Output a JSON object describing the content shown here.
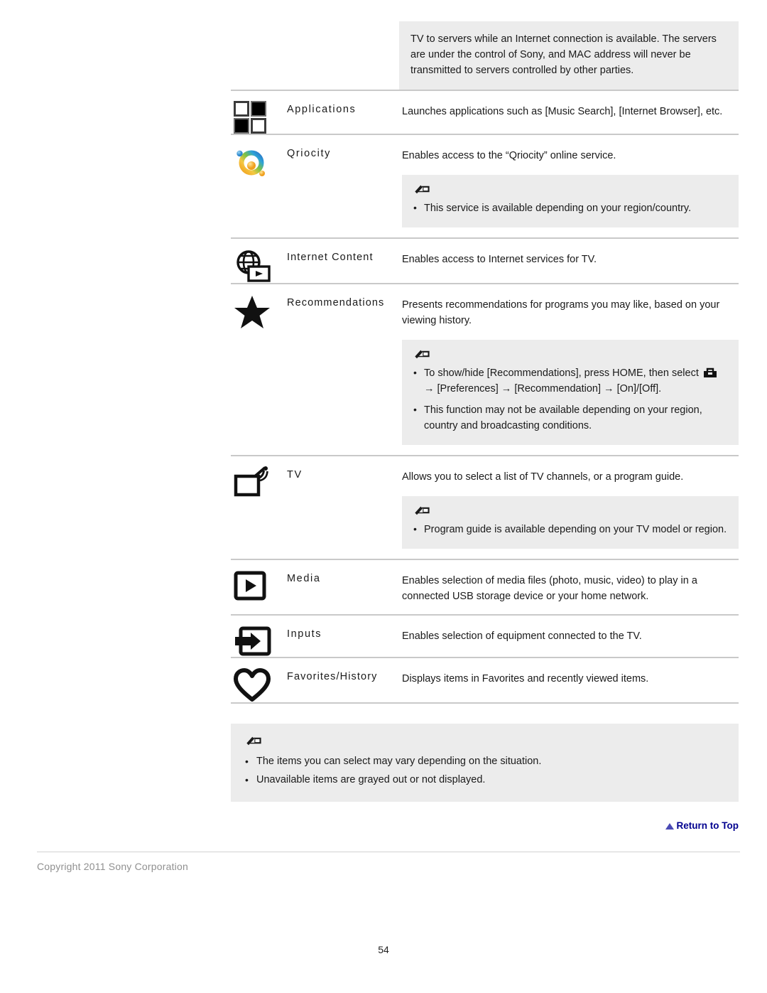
{
  "document": {
    "page_number": "54",
    "copyright": "Copyright 2011 Sony Corporation",
    "return_to_top": "Return to Top"
  },
  "carryover_note": {
    "text": "TV to servers while an Internet connection is available. The servers are under the control of Sony, and MAC address will never be transmitted to servers controlled by other parties."
  },
  "rows": [
    {
      "icon": "applications-grid-icon",
      "label": "Applications",
      "description": "Launches applications such as [Music Search], [Internet Browser], etc."
    },
    {
      "icon": "qriocity-icon",
      "label": "Qriocity",
      "description": "Enables access to the “Qriocity” online service.",
      "note": {
        "items": [
          "This service is available depending on your region/country."
        ]
      }
    },
    {
      "icon": "internet-content-globe-icon",
      "label": "Internet Content",
      "description": "Enables access to Internet services for TV."
    },
    {
      "icon": "recommendations-star-icon",
      "label": "Recommendations",
      "description": "Presents recommendations for programs you may like, based on your viewing history.",
      "note": {
        "items_rich": [
          {
            "before": "To show/hide [Recommendations], press HOME, then select ",
            "icon": "toolbox-icon",
            "after": " → [Preferences] → [Recommendation] → [On]/[Off]."
          },
          {
            "before": "This function may not be available depending on your region, country and broadcasting conditions.",
            "icon": null,
            "after": ""
          }
        ]
      }
    },
    {
      "icon": "tv-antenna-icon",
      "label": "TV",
      "description": "Allows you to select a list of TV channels, or a program guide.",
      "note": {
        "items": [
          "Program guide is available depending on your TV model or region."
        ]
      }
    },
    {
      "icon": "media-play-icon",
      "label": "Media",
      "description": "Enables selection of media files (photo, music, video) to play in a connected USB storage device or your home network."
    },
    {
      "icon": "inputs-arrow-icon",
      "label": "Inputs",
      "description": "Enables selection of equipment connected to the TV."
    },
    {
      "icon": "favorites-heart-icon",
      "label": "Favorites/History",
      "description": "Displays items in Favorites and recently viewed items."
    }
  ],
  "bottom_note": {
    "items": [
      "The items you can select may vary depending on the situation.",
      "Unavailable items are grayed out or not displayed."
    ]
  },
  "colors": {
    "note_background": "#ececec",
    "divider": "#c9c9c9",
    "link": "#00008f",
    "footer_text": "#909090"
  }
}
